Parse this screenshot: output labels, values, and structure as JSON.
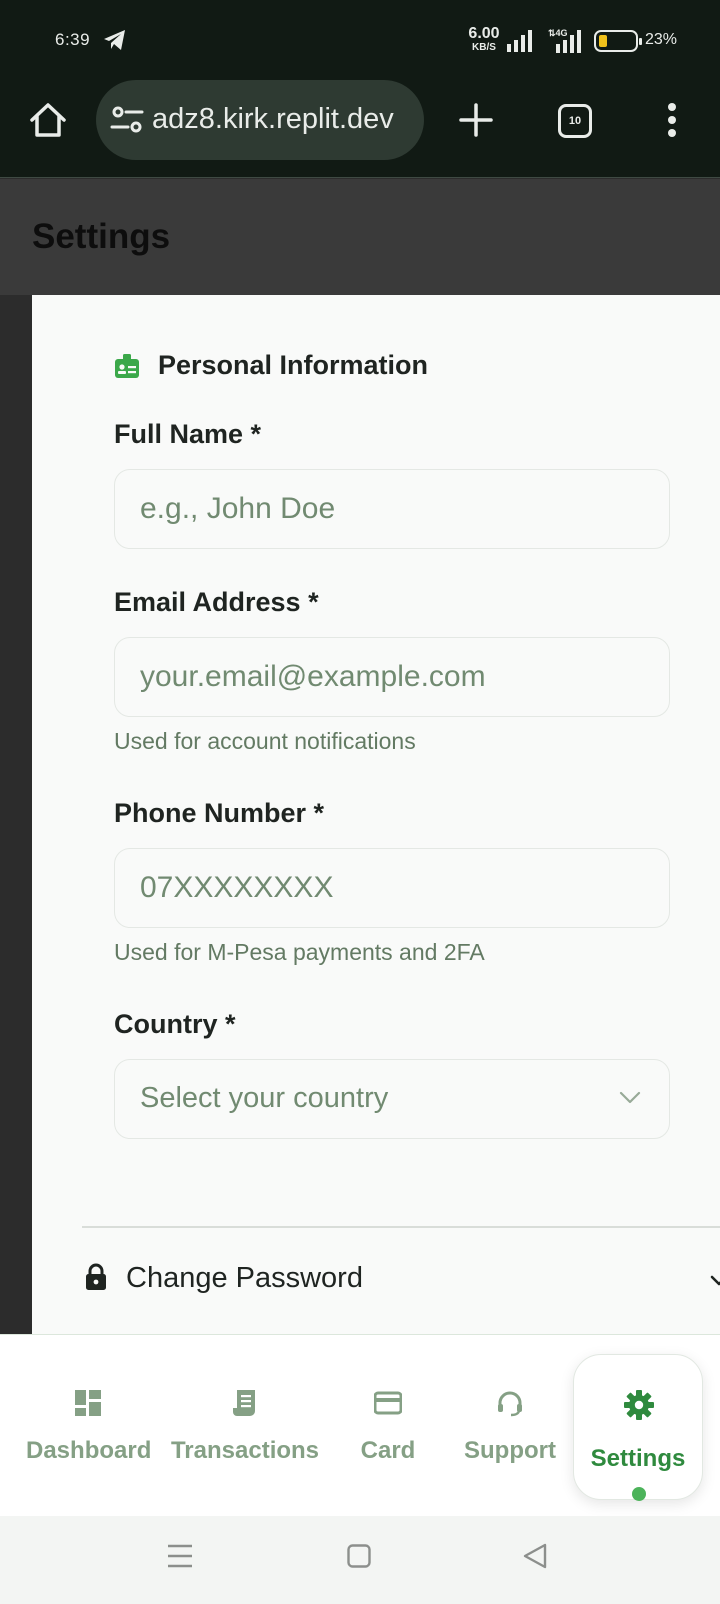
{
  "status_bar": {
    "time": "6:39",
    "net_speed_value": "6.00",
    "net_speed_unit": "KB/S",
    "battery_percent": "23%",
    "battery_level": 0.23
  },
  "browser": {
    "url": "adz8.kirk.replit.dev",
    "tab_count": "10"
  },
  "page": {
    "title": "Settings"
  },
  "personal_info": {
    "section_title": "Personal Information",
    "full_name": {
      "label": "Full Name *",
      "placeholder": "e.g., John Doe",
      "value": ""
    },
    "email": {
      "label": "Email Address *",
      "placeholder": "your.email@example.com",
      "value": "",
      "hint": "Used for account notifications"
    },
    "phone": {
      "label": "Phone Number *",
      "placeholder": "07XXXXXXXX",
      "value": "",
      "hint": "Used for M-Pesa payments and 2FA"
    },
    "country": {
      "label": "Country *",
      "placeholder": "Select your country"
    }
  },
  "change_password": {
    "label": "Change Password"
  },
  "bottom_nav": {
    "items": [
      {
        "label": "Dashboard",
        "icon": "dashboard-icon"
      },
      {
        "label": "Transactions",
        "icon": "receipt-icon"
      },
      {
        "label": "Card",
        "icon": "credit-card-icon"
      },
      {
        "label": "Support",
        "icon": "headset-icon"
      },
      {
        "label": "Settings",
        "icon": "gear-icon",
        "active": true
      }
    ]
  },
  "colors": {
    "accent": "#2f8a3e",
    "inactive_nav": "#85a085",
    "browser_chrome": "#111a14"
  }
}
